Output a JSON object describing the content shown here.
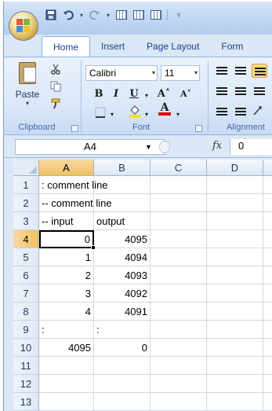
{
  "quick_access": {
    "icons": [
      "save-icon",
      "undo-icon",
      "redo-icon",
      "grid-icon",
      "grid-icon",
      "grid-icon",
      "dropdown-icon"
    ]
  },
  "tabs": [
    {
      "label": "Home",
      "active": true
    },
    {
      "label": "Insert",
      "active": false
    },
    {
      "label": "Page Layout",
      "active": false
    },
    {
      "label": "Form",
      "active": false
    }
  ],
  "ribbon": {
    "clipboard": {
      "paste_label": "Paste",
      "group_label": "Clipboard"
    },
    "font": {
      "font_name": "Calibri",
      "font_size": "11",
      "bold": "B",
      "italic": "I",
      "underline": "U",
      "grow": "A˄",
      "shrink": "A˅",
      "font_color_glyph": "A",
      "group_label": "Font"
    },
    "alignment": {
      "group_label": "Alignment"
    },
    "colors": {
      "font_color_bar": "#e00000",
      "fill_color_bar": "#f7e600",
      "highlight": "#f8d888"
    }
  },
  "formula_bar": {
    "name_box": "A4",
    "fx_label": "fx",
    "value": "0"
  },
  "sheet": {
    "columns": [
      "A",
      "B",
      "C",
      "D"
    ],
    "selected_column": "A",
    "selected_row": "4",
    "rows": [
      {
        "n": "1",
        "a": ": comment line",
        "b": ""
      },
      {
        "n": "2",
        "a": "-- comment line",
        "b": ""
      },
      {
        "n": "3",
        "a": "-- input",
        "b": "output"
      },
      {
        "n": "4",
        "a": "0",
        "b": "4095"
      },
      {
        "n": "5",
        "a": "1",
        "b": "4094"
      },
      {
        "n": "6",
        "a": "2",
        "b": "4093"
      },
      {
        "n": "7",
        "a": "3",
        "b": "4092"
      },
      {
        "n": "8",
        "a": "4",
        "b": "4091"
      },
      {
        "n": "9",
        "a": ":",
        "b": ":"
      },
      {
        "n": "10",
        "a": "4095",
        "b": "0"
      },
      {
        "n": "11",
        "a": "",
        "b": ""
      },
      {
        "n": "12",
        "a": "",
        "b": ""
      },
      {
        "n": "13",
        "a": "",
        "b": ""
      }
    ]
  }
}
